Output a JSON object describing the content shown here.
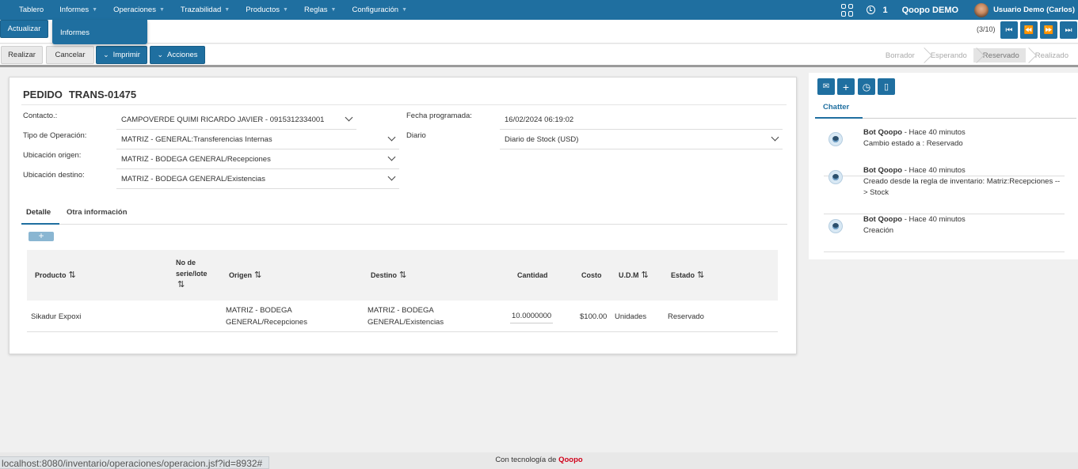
{
  "topnav": {
    "items": [
      {
        "label": "Tablero",
        "chevron": false
      },
      {
        "label": "Informes",
        "chevron": true
      },
      {
        "label": "Operaciones",
        "chevron": true
      },
      {
        "label": "Trazabilidad",
        "chevron": true
      },
      {
        "label": "Productos",
        "chevron": true
      },
      {
        "label": "Reglas",
        "chevron": true
      },
      {
        "label": "Configuración",
        "chevron": true
      }
    ],
    "notification_count": "1",
    "company": "Qoopo DEMO",
    "user": "Usuario Demo (Carlos)"
  },
  "toolbar": {
    "refresh_label": "Actualizar",
    "dropdown_item": "Informes",
    "pager": "(3/10)",
    "pager_icons": [
      "⏮",
      "⏪",
      "⏩",
      "⏭"
    ]
  },
  "actions": {
    "done_label": "Realizar",
    "cancel_label": "Cancelar",
    "print_label": "Imprimir",
    "actions_label": "Acciones",
    "statuses": [
      {
        "label": "Borrador",
        "active": false
      },
      {
        "label": "Esperando",
        "active": false
      },
      {
        "label": "Reservado",
        "active": true
      },
      {
        "label": "Realizado",
        "active": false
      }
    ]
  },
  "form": {
    "title_prefix": "PEDIDO",
    "title_number": "TRANS-01475",
    "contact_label": "Contacto.:",
    "contact_value": "CAMPOVERDE QUIMI RICARDO JAVIER - 0915312334001",
    "op_type_label": "Tipo de Operación:",
    "op_type_value": "MATRIZ - GENERAL:Transferencias Internas",
    "origin_label": "Ubicación origen:",
    "origin_value": "MATRIZ - BODEGA GENERAL/Recepciones",
    "dest_label": "Ubicación destino:",
    "dest_value": "MATRIZ - BODEGA GENERAL/Existencias",
    "date_label": "Fecha programada:",
    "date_value": "16/02/2024 06:19:02",
    "journal_label": "Diario",
    "journal_value": "Diario de Stock (USD)"
  },
  "tabs": {
    "detail": "Detalle",
    "other": "Otra información",
    "add": "+"
  },
  "table": {
    "headers": {
      "product": "Producto",
      "serial_1": "No de",
      "serial_2": "serie/lote",
      "origin": "Origen",
      "dest": "Destino",
      "qty": "Cantidad",
      "cost": "Costo",
      "uom": "U.D.M",
      "state": "Estado",
      "sort": "⇅"
    },
    "rows": [
      {
        "product": "Sikadur Expoxi",
        "origin_1": "MATRIZ - BODEGA",
        "origin_2": "GENERAL/Recepciones",
        "dest_1": "MATRIZ - BODEGA",
        "dest_2": "GENERAL/Existencias",
        "qty": "10.0000000",
        "cost": "$100.00",
        "uom": "Unidades",
        "state": "Reservado"
      }
    ]
  },
  "chatter": {
    "tab": "Chatter",
    "buttons": [
      "✉",
      "+",
      "◷",
      "▯"
    ],
    "messages": [
      {
        "author": "Bot Qoopo",
        "time": " - Hace 40 minutos",
        "line1": "Cambio estado a : Reservado",
        "line2": ""
      },
      {
        "author": "Bot Qoopo",
        "time": " - Hace 40 minutos",
        "line1": "Creado desde la regla de inventario: Matriz:Recepciones --",
        "line2": "> Stock"
      },
      {
        "author": "Bot Qoopo",
        "time": " - Hace 40 minutos",
        "line1": "Creación",
        "line2": ""
      }
    ]
  },
  "footer": {
    "prefix": "Con tecnología de ",
    "brand": "Qoopo",
    "status_url": "localhost:8080/inventario/operaciones/operacion.jsf?id=8932#"
  }
}
